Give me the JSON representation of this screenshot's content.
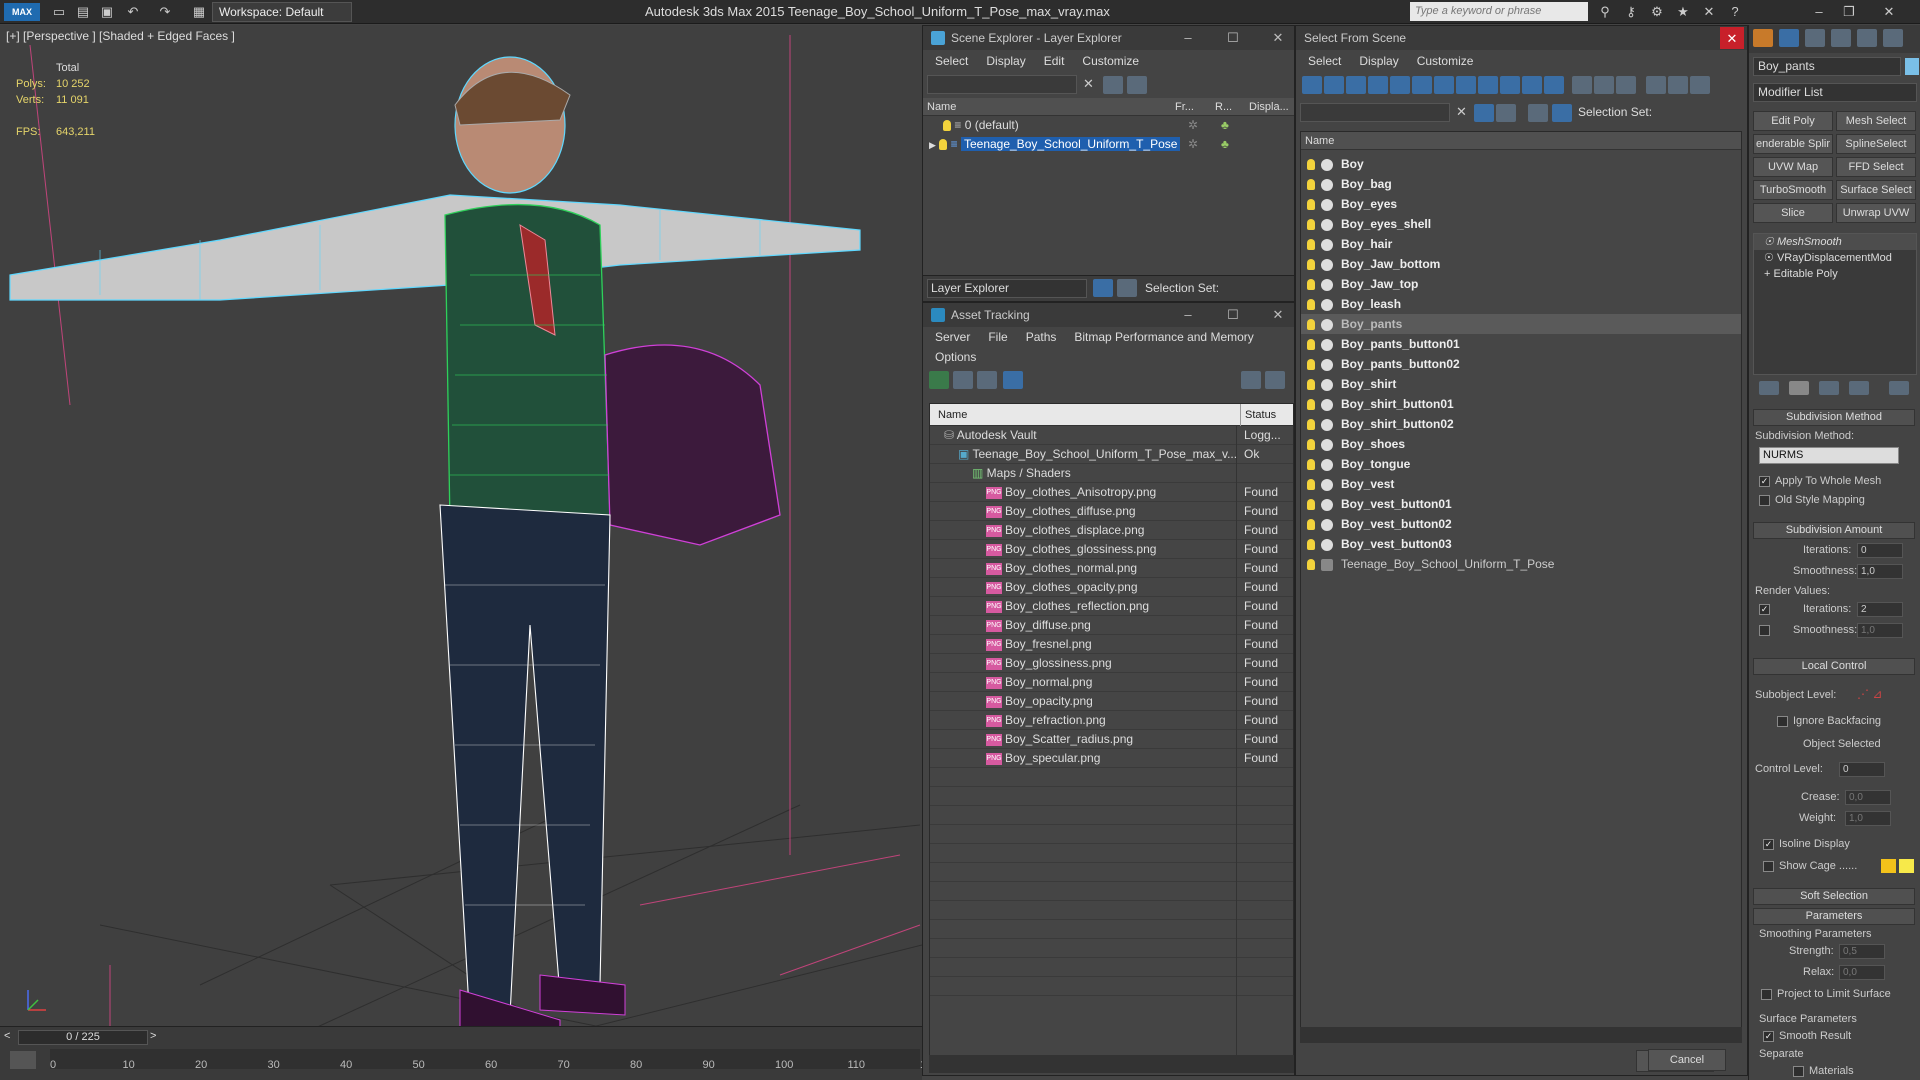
{
  "titlebar": {
    "app_icon": "MAX",
    "workspace": "Workspace: Default",
    "title": "Autodesk 3ds Max  2015     Teenage_Boy_School_Uniform_T_Pose_max_vray.max",
    "search_placeholder": "Type a keyword or phrase"
  },
  "viewport": {
    "label": "[+] [Perspective ] [Shaded + Edged Faces ]",
    "stats": {
      "total_label": "Total",
      "polys_label": "Polys:",
      "polys": "10 252",
      "verts_label": "Verts:",
      "verts": "11 091",
      "fps_label": "FPS:",
      "fps": "643,211"
    }
  },
  "timeline": {
    "frame": "0 / 225",
    "ticks": [
      "0",
      "10",
      "20",
      "30",
      "40",
      "50",
      "60",
      "70",
      "80",
      "90",
      "100",
      "110",
      "12"
    ]
  },
  "scene_explorer": {
    "title": "Scene Explorer - Layer Explorer",
    "menu": [
      "Select",
      "Display",
      "Edit",
      "Customize"
    ],
    "columns": [
      "Name",
      "Fr...",
      "R...",
      "Displa..."
    ],
    "rows": [
      "0 (default)",
      "Teenage_Boy_School_Uniform_T_Pose"
    ],
    "footer_mode": "Layer Explorer",
    "footer_selset": "Selection Set:"
  },
  "asset_tracking": {
    "title": "Asset Tracking",
    "menu": [
      "Server",
      "File",
      "Paths",
      "Bitmap Performance and Memory"
    ],
    "menu2": "Options",
    "columns": [
      "Name",
      "Status"
    ],
    "rows": [
      {
        "name": "Autodesk Vault",
        "status": "Logg...",
        "indent": 1
      },
      {
        "name": "Teenage_Boy_School_Uniform_T_Pose_max_v...",
        "status": "Ok",
        "indent": 2
      },
      {
        "name": "Maps / Shaders",
        "status": "",
        "indent": 3
      },
      {
        "name": "Boy_clothes_Anisotropy.png",
        "status": "Found",
        "indent": 4
      },
      {
        "name": "Boy_clothes_diffuse.png",
        "status": "Found",
        "indent": 4
      },
      {
        "name": "Boy_clothes_displace.png",
        "status": "Found",
        "indent": 4
      },
      {
        "name": "Boy_clothes_glossiness.png",
        "status": "Found",
        "indent": 4
      },
      {
        "name": "Boy_clothes_normal.png",
        "status": "Found",
        "indent": 4
      },
      {
        "name": "Boy_clothes_opacity.png",
        "status": "Found",
        "indent": 4
      },
      {
        "name": "Boy_clothes_reflection.png",
        "status": "Found",
        "indent": 4
      },
      {
        "name": "Boy_diffuse.png",
        "status": "Found",
        "indent": 4
      },
      {
        "name": "Boy_fresnel.png",
        "status": "Found",
        "indent": 4
      },
      {
        "name": "Boy_glossiness.png",
        "status": "Found",
        "indent": 4
      },
      {
        "name": "Boy_normal.png",
        "status": "Found",
        "indent": 4
      },
      {
        "name": "Boy_opacity.png",
        "status": "Found",
        "indent": 4
      },
      {
        "name": "Boy_refraction.png",
        "status": "Found",
        "indent": 4
      },
      {
        "name": "Boy_Scatter_radius.png",
        "status": "Found",
        "indent": 4
      },
      {
        "name": "Boy_specular.png",
        "status": "Found",
        "indent": 4
      }
    ]
  },
  "select_from_scene": {
    "title": "Select From Scene",
    "menu": [
      "Select",
      "Display",
      "Customize"
    ],
    "selset": "Selection Set:",
    "col": "Name",
    "items": [
      "Boy",
      "Boy_bag",
      "Boy_eyes",
      "Boy_eyes_shell",
      "Boy_hair",
      "Boy_Jaw_bottom",
      "Boy_Jaw_top",
      "Boy_leash",
      "Boy_pants",
      "Boy_pants_button01",
      "Boy_pants_button02",
      "Boy_shirt",
      "Boy_shirt_button01",
      "Boy_shirt_button02",
      "Boy_shoes",
      "Boy_tongue",
      "Boy_vest",
      "Boy_vest_button01",
      "Boy_vest_button02",
      "Boy_vest_button03",
      "Teenage_Boy_School_Uniform_T_Pose"
    ],
    "selected": "Boy_pants",
    "ok": "OK",
    "cancel": "Cancel"
  },
  "command_panel": {
    "object_name": "Boy_pants",
    "modifier_list": "Modifier List",
    "buttons": [
      "Edit Poly",
      "Mesh Select",
      "enderable Splir",
      "SplineSelect",
      "UVW Map",
      "FFD Select",
      "TurboSmooth",
      "Surface Select",
      "Slice",
      "Unwrap UVW"
    ],
    "stack": [
      "MeshSmooth",
      "VRayDisplacementMod",
      "Editable Poly"
    ],
    "subdiv_method_title": "Subdivision Method",
    "subdiv_method_label": "Subdivision Method:",
    "subdiv_method": "NURMS",
    "apply_whole": "Apply To Whole Mesh",
    "old_style": "Old Style Mapping",
    "subdiv_amount_title": "Subdivision Amount",
    "iterations_label": "Iterations:",
    "iterations": "0",
    "smoothness_label": "Smoothness:",
    "smoothness": "1,0",
    "render_values": "Render Values:",
    "r_iterations": "2",
    "r_smoothness": "1,0",
    "local_control_title": "Local Control",
    "subobject_level": "Subobject Level:",
    "ignore_backfacing": "Ignore Backfacing",
    "object_selected": "Object Selected",
    "control_level_label": "Control Level:",
    "control_level": "0",
    "crease_label": "Crease:",
    "crease": "0,0",
    "weight_label": "Weight:",
    "weight": "1,0",
    "isoline": "Isoline Display",
    "show_cage": "Show Cage ......",
    "soft_selection_title": "Soft Selection",
    "parameters_title": "Parameters",
    "smoothing_params": "Smoothing Parameters",
    "strength_label": "Strength:",
    "strength": "0,5",
    "relax_label": "Relax:",
    "relax": "0,0",
    "project_limit": "Project to Limit Surface",
    "surface_params": "Surface Parameters",
    "smooth_result": "Smooth Result",
    "separate": "Separate",
    "materials": "Materials"
  },
  "colors": {
    "selected_blue": "#1f5fae",
    "bulb": "#f3d33c",
    "wire_green": "#2fd05a",
    "wire_cyan": "#5fd8ff",
    "wire_magenta": "#d040d8"
  }
}
